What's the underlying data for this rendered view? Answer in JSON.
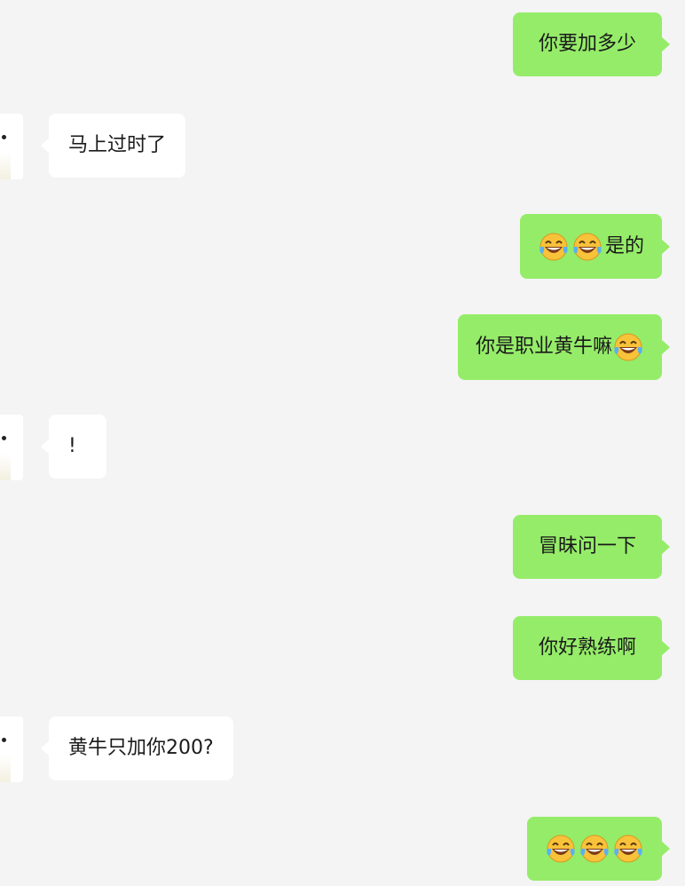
{
  "messages": [
    {
      "side": "sent",
      "text": "你要加多少",
      "emoji_before": 0,
      "emoji_after": 0
    },
    {
      "side": "recv",
      "text": "马上过时了"
    },
    {
      "side": "sent",
      "text": "是的",
      "emoji_before": 2,
      "emoji_after": 0
    },
    {
      "side": "sent",
      "text": "你是职业黄牛嘛",
      "emoji_before": 0,
      "emoji_after": 1
    },
    {
      "side": "recv",
      "text": "!"
    },
    {
      "side": "sent",
      "text": "冒昧问一下",
      "emoji_before": 0,
      "emoji_after": 0
    },
    {
      "side": "sent",
      "text": "你好熟练啊",
      "emoji_before": 0,
      "emoji_after": 0
    },
    {
      "side": "recv",
      "text": "黄牛只加你200?"
    },
    {
      "side": "sent",
      "text": "",
      "emoji_before": 3,
      "emoji_after": 0
    }
  ],
  "emoji_icon": "tears-of-joy-emoji",
  "colors": {
    "sent_bubble": "#95ec69",
    "recv_bubble": "#ffffff",
    "background": "#f4f4f4"
  }
}
